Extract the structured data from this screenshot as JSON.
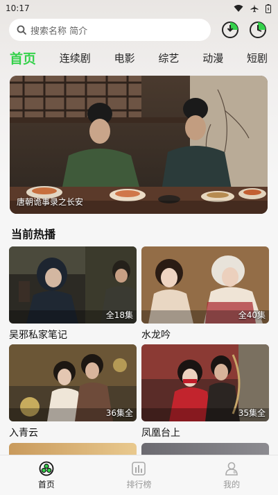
{
  "status": {
    "time": "10:17"
  },
  "search": {
    "placeholder": "搜索名称 简介"
  },
  "nav": {
    "tabs": [
      {
        "label": "首页",
        "active": true
      },
      {
        "label": "连续剧"
      },
      {
        "label": "电影"
      },
      {
        "label": "综艺"
      },
      {
        "label": "动漫"
      },
      {
        "label": "短剧"
      }
    ]
  },
  "banner": {
    "caption": "唐朝诡事录之长安"
  },
  "section": {
    "title": "当前热播"
  },
  "cards": [
    {
      "title": "吴邪私家笔记",
      "badge": "全18集"
    },
    {
      "title": "水龙吟",
      "badge": "全40集"
    },
    {
      "title": "入青云",
      "badge": "36集全"
    },
    {
      "title": "凤凰台上",
      "badge": "35集全"
    }
  ],
  "bottom_nav": {
    "items": [
      {
        "label": "首页",
        "icon": "home-icon",
        "active": true
      },
      {
        "label": "排行榜",
        "icon": "ranking-icon"
      },
      {
        "label": "我的",
        "icon": "profile-icon"
      }
    ]
  },
  "colors": {
    "accent": "#35d14b",
    "text": "#111111",
    "muted": "#999999"
  }
}
